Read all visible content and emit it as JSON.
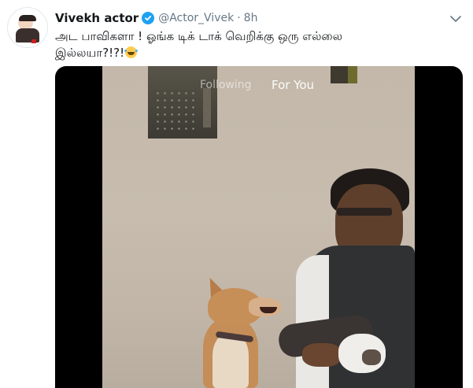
{
  "tweet": {
    "author": {
      "name": "Vivekh actor",
      "verified": true,
      "handle": "@Actor_Vivek",
      "separator": "·",
      "time": "8h"
    },
    "text_line1": "அட பாவிகளா ! ஓங்க டிக் டாக் வெறிக்கு ஒரு எல்லை",
    "text_line2": "இல்லயா?!?!",
    "emoji": "face-with-tears-of-joy",
    "menu_icon": "chevron-down-icon"
  },
  "video": {
    "tabs": [
      {
        "label": "Following",
        "active": false
      },
      {
        "label": "For You",
        "active": true
      }
    ]
  },
  "colors": {
    "link_blue": "#1da1f2",
    "text": "#14171a",
    "secondary": "#657786",
    "background": "#ffffff"
  }
}
